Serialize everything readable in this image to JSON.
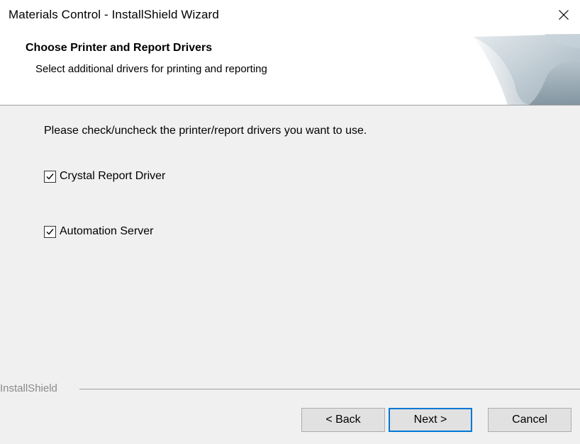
{
  "window": {
    "title": "Materials Control - InstallShield Wizard",
    "close_icon": "close-icon"
  },
  "header": {
    "title": "Choose Printer and Report Drivers",
    "subtitle": "Select additional drivers for printing and reporting"
  },
  "main": {
    "instruction": "Please check/uncheck the printer/report drivers you want to use.",
    "options": [
      {
        "label": "Crystal Report Driver",
        "checked": true
      },
      {
        "label": "Automation Server",
        "checked": true
      }
    ]
  },
  "footer": {
    "brand": "InstallShield",
    "back_label": "< Back",
    "next_label": "Next >",
    "cancel_label": "Cancel"
  },
  "colors": {
    "accent": "#0078d7",
    "background": "#f0f0f0",
    "banner": "#ffffff"
  }
}
